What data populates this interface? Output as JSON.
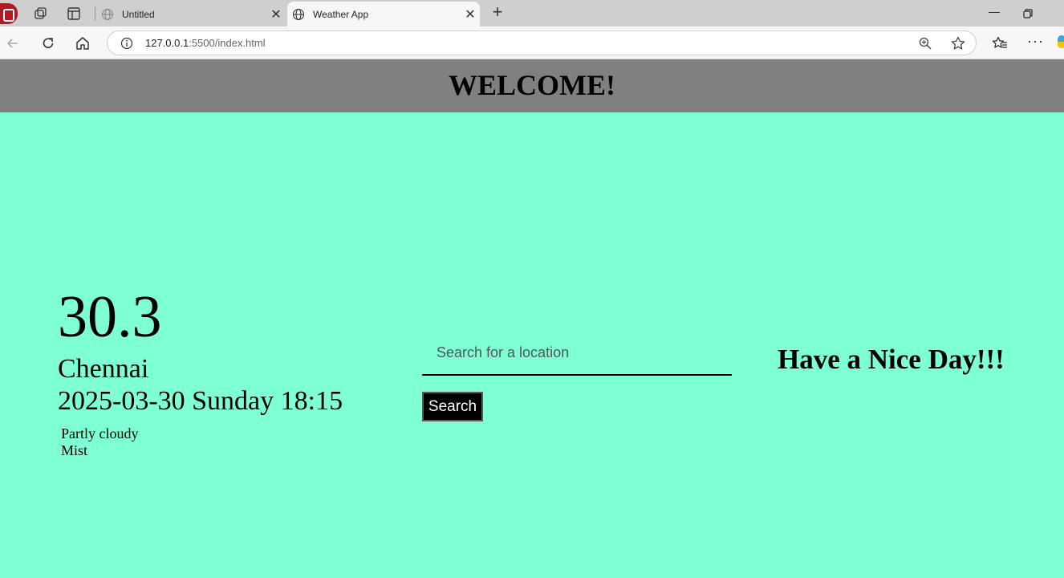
{
  "browser": {
    "tabs": [
      {
        "title": "Untitled",
        "active": false
      },
      {
        "title": "Weather App",
        "active": true
      }
    ],
    "url_host": "127.0.0.1",
    "url_path": ":5500/index.html",
    "icons": [
      "profile-avatar-icon",
      "workspaces-icon",
      "vertical-tabs-icon",
      "globe-icon",
      "close-icon",
      "plus-icon",
      "minimize-icon",
      "restore-icon",
      "close-window-icon",
      "back-icon",
      "refresh-icon",
      "home-icon",
      "info-icon",
      "zoom-icon",
      "star-icon",
      "favorites-icon",
      "more-icon"
    ]
  },
  "page": {
    "header": "WELCOME!",
    "weather": {
      "temperature": "30.3",
      "city": "Chennai",
      "datetime": "2025-03-30 Sunday 18:15",
      "conditions": [
        "Partly cloudy",
        "Mist"
      ]
    },
    "search": {
      "placeholder": "Search for a location",
      "value": "",
      "button_label": "Search"
    },
    "greeting": "Have a Nice Day!!!"
  },
  "colors": {
    "page_background": "#7fffd4",
    "header_background": "#808080",
    "button_background": "#000000"
  }
}
